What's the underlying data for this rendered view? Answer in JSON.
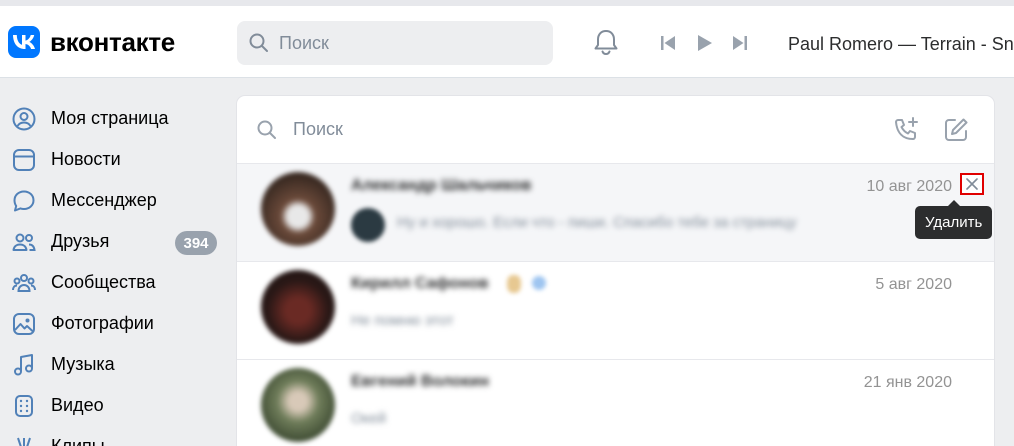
{
  "header": {
    "logo_text": "вконтакте",
    "search_placeholder": "Поиск",
    "now_playing": "Paul Romero — Terrain - Snow"
  },
  "sidebar": {
    "items": [
      {
        "label": "Моя страница",
        "icon": "user-circle-icon"
      },
      {
        "label": "Новости",
        "icon": "news-icon"
      },
      {
        "label": "Мессенджер",
        "icon": "message-icon"
      },
      {
        "label": "Друзья",
        "icon": "friends-icon",
        "badge": "394"
      },
      {
        "label": "Сообщества",
        "icon": "communities-icon"
      },
      {
        "label": "Фотографии",
        "icon": "photo-icon"
      },
      {
        "label": "Музыка",
        "icon": "music-icon"
      },
      {
        "label": "Видео",
        "icon": "video-icon"
      },
      {
        "label": "Клипы",
        "icon": "clips-icon"
      }
    ]
  },
  "messenger": {
    "search_placeholder": "Поиск",
    "conversations": [
      {
        "name": "Александр Шальчиков",
        "date": "10 авг 2020",
        "snippet": "Ну и хорошо. Если что - пиши. Спасибо тебе за страницу"
      },
      {
        "name": "Кирилл Сафонов",
        "date": "5 авг 2020",
        "snippet": "Не помню этот"
      },
      {
        "name": "Евгений Волокин",
        "date": "21 янв 2020",
        "snippet": "Окей"
      }
    ],
    "tooltip": "Удалить"
  },
  "colors": {
    "brand": "#0077ff",
    "highlight": "#e00000"
  }
}
